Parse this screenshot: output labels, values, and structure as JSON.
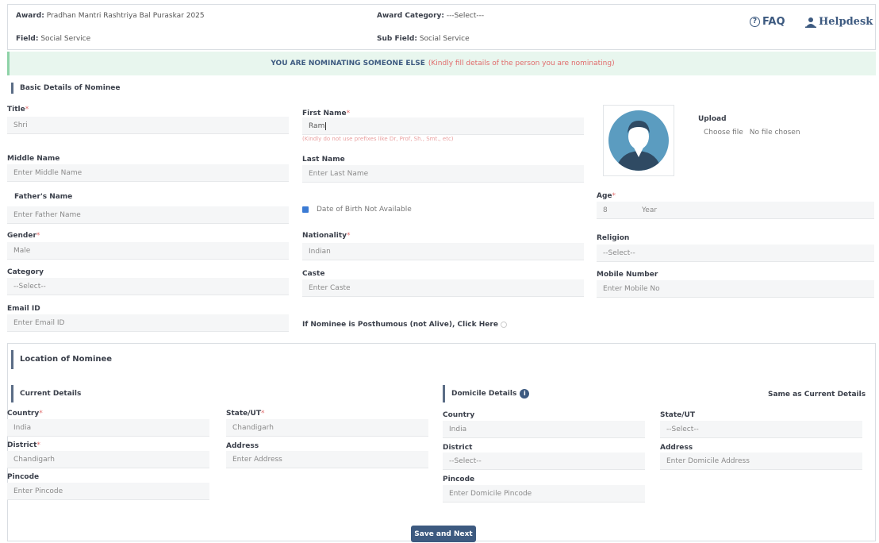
{
  "header": {
    "award_label": "Award:",
    "award_value": "Pradhan Mantri Rashtriya Bal Puraskar 2025",
    "award_category_label": "Award Category:",
    "award_category_value": "---Select---",
    "field_label": "Field:",
    "field_value": "Social Service",
    "sub_field_label": "Sub Field:",
    "sub_field_value": "Social Service",
    "faq_label": "FAQ",
    "helpdesk_label": "Helpdesk"
  },
  "banner": {
    "main": "YOU ARE NOMINATING SOMEONE ELSE",
    "note": "(Kindly fill details of the person you are nominating)"
  },
  "basic": {
    "section_title": "Basic Details of Nominee",
    "title_label": "Title",
    "title_value": "Shri",
    "first_name_label": "First Name",
    "first_name_value": "Ram",
    "first_name_hint": "(Kindly do not use prefixes like Dr, Prof, Sh., Smt., etc)",
    "upload_label": "Upload",
    "choose_file_label": "Choose file",
    "no_file_label": "No file chosen",
    "middle_name_label": "Middle Name",
    "middle_name_placeholder": "Enter Middle Name",
    "last_name_label": "Last Name",
    "last_name_placeholder": "Enter Last Name",
    "father_label": "Father's Name",
    "father_placeholder": "Enter Father Name",
    "dob_na_label": "Date of Birth Not Available",
    "age_label": "Age",
    "age_value": "8",
    "age_unit": "Year",
    "gender_label": "Gender",
    "gender_value": "Male",
    "nationality_label": "Nationality",
    "nationality_value": "Indian",
    "religion_label": "Religion",
    "religion_value": "--Select--",
    "category_label": "Category",
    "category_value": "--Select--",
    "caste_label": "Caste",
    "caste_placeholder": "Enter Caste",
    "mobile_label": "Mobile Number",
    "mobile_placeholder": "Enter Mobile No",
    "email_label": "Email ID",
    "email_placeholder": "Enter Email ID",
    "posthumous_label": "If Nominee is Posthumous (not Alive), Click Here"
  },
  "location": {
    "section_title": "Location of Nominee",
    "current_title": "Current Details",
    "domicile_title": "Domicile Details",
    "same_as_current": "Same as Current Details",
    "country_label": "Country",
    "country_value": "India",
    "state_label": "State/UT",
    "state_value": "Chandigarh",
    "district_label": "District",
    "district_value": "Chandigarh",
    "address_label": "Address",
    "address_placeholder": "Enter Address",
    "pincode_label": "Pincode",
    "pincode_placeholder": "Enter Pincode",
    "dom_country_label": "Country",
    "dom_country_value": "India",
    "dom_state_label": "State/UT",
    "dom_state_value": "--Select--",
    "dom_district_label": "District",
    "dom_district_value": "--Select--",
    "dom_address_label": "Address",
    "dom_address_placeholder": "Enter Domicile Address",
    "dom_pincode_label": "Pincode",
    "dom_pincode_placeholder": "Enter Domicile Pincode"
  },
  "actions": {
    "save_next": "Save and Next"
  },
  "colors": {
    "accent": "#3d5a80",
    "banner_bg": "#e8f6ee",
    "required": "#e06b6b",
    "section_bar": "#5b6d86"
  }
}
